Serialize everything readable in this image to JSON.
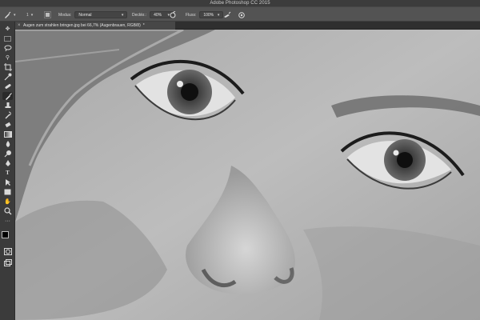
{
  "window": {
    "title": "Adobe Photoshop CC 2015"
  },
  "options_bar": {
    "mode_label": "Modus:",
    "mode_value": "Normal",
    "opacity_label": "Deckkr.:",
    "opacity_value": "40%",
    "flow_label": "Fluss:",
    "flow_value": "100%",
    "brush_size": "1"
  },
  "document": {
    "tab_title": "Augen zum strahlen bringen.jpg bei 66,7% (Augenbrauen, RGB/8)",
    "tab_dirty": "*"
  },
  "icons": {
    "close": "close-icon"
  },
  "tools": [
    "move",
    "marquee",
    "lasso",
    "quick-select",
    "crop",
    "eyedropper",
    "healing",
    "brush",
    "stamp",
    "history-brush",
    "eraser",
    "gradient",
    "blur",
    "dodge",
    "pen",
    "type",
    "path-select",
    "shape",
    "hand",
    "zoom",
    "more",
    "colors",
    "quick-mask",
    "screen-mode"
  ]
}
